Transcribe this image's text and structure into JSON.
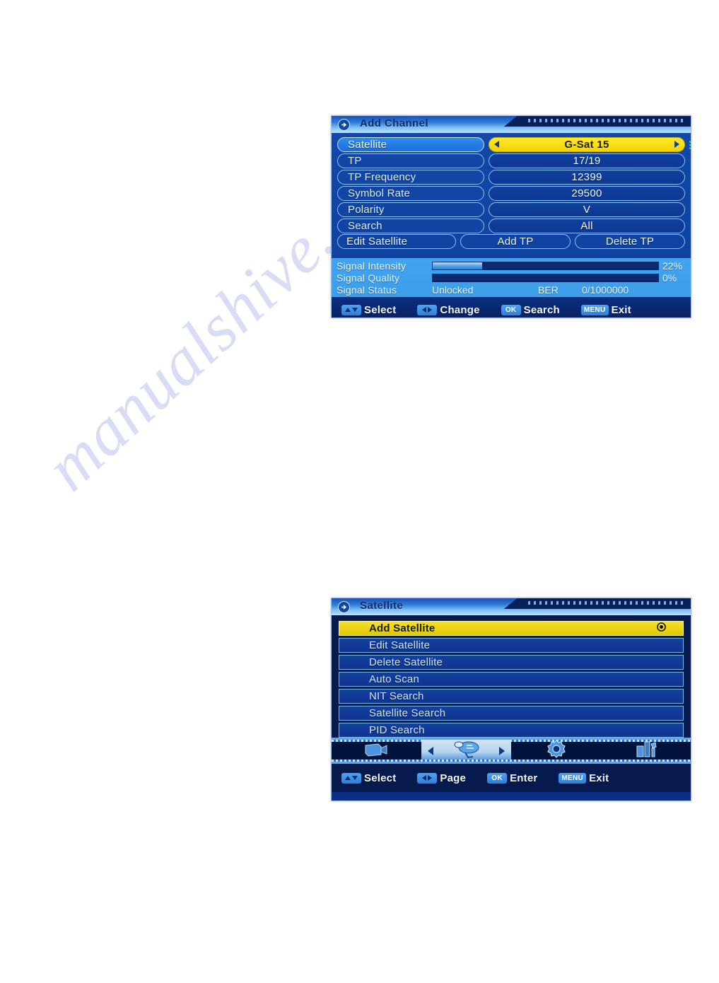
{
  "page": {
    "watermark": "manualshive.com"
  },
  "add_channel": {
    "title": "Add Channel",
    "title_icon": "arrow-circle-icon",
    "rows": [
      {
        "label": "Satellite",
        "value": "G-Sat 15",
        "selected": true,
        "highlight": true
      },
      {
        "label": "TP",
        "value": "17/19",
        "selected": false,
        "highlight": false
      },
      {
        "label": "TP Frequency",
        "value": "12399",
        "selected": false,
        "highlight": false
      },
      {
        "label": "Symbol Rate",
        "value": "29500",
        "selected": false,
        "highlight": false
      },
      {
        "label": "Polarity",
        "value": "V",
        "selected": false,
        "highlight": false
      },
      {
        "label": "Search",
        "value": "All",
        "selected": false,
        "highlight": false
      }
    ],
    "buttons": [
      {
        "label": "Edit Satellite"
      },
      {
        "label": "Add TP"
      },
      {
        "label": "Delete TP"
      }
    ],
    "signal": {
      "intensity_label": "Signal Intensity",
      "intensity_percent": 22,
      "intensity_percent_text": "22%",
      "quality_label": "Signal Quality",
      "quality_percent": 0,
      "quality_percent_text": "0%",
      "status_label": "Signal Status",
      "status_value": "Unlocked",
      "ber_label": "BER",
      "ber_value": "0/1000000"
    },
    "hints": [
      {
        "key": "up-down-arrows",
        "text": "Select"
      },
      {
        "key": "left-right-arrows",
        "text": "Change"
      },
      {
        "key": "OK",
        "text": "Search"
      },
      {
        "key": "MENU",
        "text": "Exit"
      }
    ],
    "colors": {
      "selected_value_bg": "#f2d400",
      "panel_bg": "#1042a0",
      "signal_bg": "#3d9ee9"
    }
  },
  "satellite_menu": {
    "title": "Satellite",
    "title_icon": "arrow-circle-icon",
    "items": [
      {
        "label": "Add Satellite",
        "selected": true
      },
      {
        "label": "Edit Satellite",
        "selected": false
      },
      {
        "label": "Delete Satellite",
        "selected": false
      },
      {
        "label": "Auto Scan",
        "selected": false
      },
      {
        "label": "NIT Search",
        "selected": false
      },
      {
        "label": "Satellite Search",
        "selected": false
      },
      {
        "label": "PID Search",
        "selected": false
      }
    ],
    "tabs": [
      {
        "icon": "tv-camera-icon",
        "active": false
      },
      {
        "icon": "satellite-dish-icon",
        "active": true
      },
      {
        "icon": "gear-icon",
        "active": false
      },
      {
        "icon": "tools-icon",
        "active": false
      }
    ],
    "hints": [
      {
        "key": "up-down-arrows",
        "text": "Select"
      },
      {
        "key": "left-right-arrows",
        "text": "Page"
      },
      {
        "key": "OK",
        "text": "Enter"
      },
      {
        "key": "MENU",
        "text": "Exit"
      }
    ],
    "colors": {
      "selected_row_bg": "#e3c800",
      "menu_bg": "#061a4d"
    }
  }
}
